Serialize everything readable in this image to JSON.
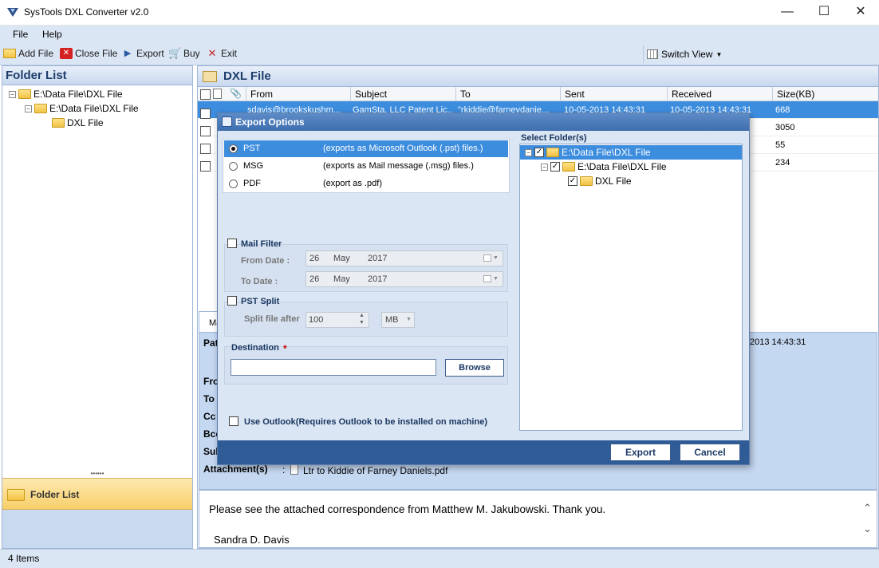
{
  "window": {
    "title": "SysTools DXL Converter v2.0",
    "minimize": "—",
    "maximize": "☐",
    "close": "✕"
  },
  "menu": {
    "file": "File",
    "help": "Help"
  },
  "toolbar": {
    "add_file": "Add File",
    "close_file": "Close File",
    "export": "Export",
    "buy": "Buy",
    "exit": "Exit",
    "switch_view": "Switch View"
  },
  "folder_list": {
    "title": "Folder List",
    "tree": [
      "E:\\Data File\\DXL File",
      "E:\\Data File\\DXL File",
      "DXL File"
    ],
    "bottom_label": "Folder List"
  },
  "dxl_panel": {
    "title": "DXL File",
    "columns": [
      "From",
      "Subject",
      "To",
      "Sent",
      "Received",
      "Size(KB)"
    ],
    "rows": [
      {
        "from": "sdavis@brookskushm...",
        "subject": "GamSta, LLC Patent Lic...",
        "to": "\"rkiddie@farneydanie...",
        "sent": "10-05-2013 14:43:31",
        "received": "10-05-2013 14:43:31",
        "size": "668"
      },
      {
        "size": "3050"
      },
      {
        "size": "55"
      },
      {
        "size": "234"
      }
    ]
  },
  "preview": {
    "tab": "Ma",
    "date_tail": "2013 14:43:31",
    "labels": {
      "path": "Pat",
      "from": "Fro",
      "to": "To",
      "cc": "Cc",
      "bcc": "Bcc",
      "subject": "Sub",
      "attachments": "Attachment(s)"
    },
    "attachment_sep": ":",
    "attachment": "Ltr to Kiddie of Farney Daniels.pdf",
    "body_line1": "Please see the attached correspondence from Matthew M. Jakubowski.  Thank you.",
    "body_line2": "Sandra D. Davis"
  },
  "status": {
    "items": "4 Items"
  },
  "export_dialog": {
    "title": "Export Options",
    "options": [
      {
        "name": "PST",
        "desc": "(exports as Microsoft Outlook (.pst) files.)",
        "selected": true
      },
      {
        "name": "MSG",
        "desc": "(exports as Mail message (.msg) files.)",
        "selected": false
      },
      {
        "name": "PDF",
        "desc": "(export as .pdf)",
        "selected": false
      }
    ],
    "mail_filter": {
      "label": "Mail Filter",
      "from_label": "From Date :",
      "to_label": "To Date :",
      "from": {
        "day": "26",
        "month": "May",
        "year": "2017"
      },
      "to": {
        "day": "26",
        "month": "May",
        "year": "2017"
      }
    },
    "pst_split": {
      "label": "PST Split",
      "split_label": "Split file after",
      "value": "100",
      "unit": "MB"
    },
    "destination": {
      "label": "Destination",
      "required": "*",
      "value": "",
      "browse": "Browse"
    },
    "use_outlook": "Use Outlook(Requires Outlook to be installed on machine)",
    "select_folders": {
      "label": "Select Folder(s)",
      "items": [
        "E:\\Data File\\DXL File",
        "E:\\Data File\\DXL File",
        "DXL File"
      ]
    },
    "export_btn": "Export",
    "cancel_btn": "Cancel"
  }
}
